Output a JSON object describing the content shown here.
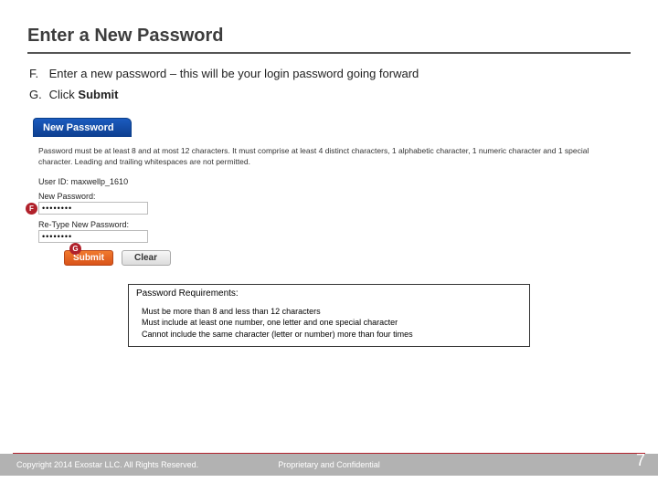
{
  "title": "Enter a New Password",
  "steps": {
    "f": {
      "letter": "F.",
      "text_before": "Enter a new password – this will be your login password going forward"
    },
    "g": {
      "letter": "G.",
      "text_before": "Click ",
      "bold": "Submit"
    }
  },
  "panel": {
    "tab_label": "New Password",
    "rules_text": "Password must be at least 8 and at most 12 characters. It must comprise at least 4 distinct characters, 1 alphabetic character, 1 numeric character and 1 special character. Leading and trailing whitespaces are not permitted.",
    "user_id_label": "User ID:",
    "user_id_value": "maxwellp_1610",
    "new_pwd_label": "New Password:",
    "new_pwd_value": "••••••••",
    "retype_label": "Re-Type New Password:",
    "retype_value": "••••••••",
    "submit_label": "Submit",
    "clear_label": "Clear"
  },
  "callouts": {
    "f": "F",
    "g": "G"
  },
  "req_box": {
    "title": "Password Requirements:",
    "line1": "Must be more than 8 and less than 12 characters",
    "line2": "Must include at least one number, one letter and one special character",
    "line3": "Cannot include the same character (letter or number) more than four times"
  },
  "footer": {
    "copyright": "Copyright 2014 Exostar LLC. All Rights Reserved.",
    "proprietary": "Proprietary and Confidential",
    "page": "7"
  }
}
